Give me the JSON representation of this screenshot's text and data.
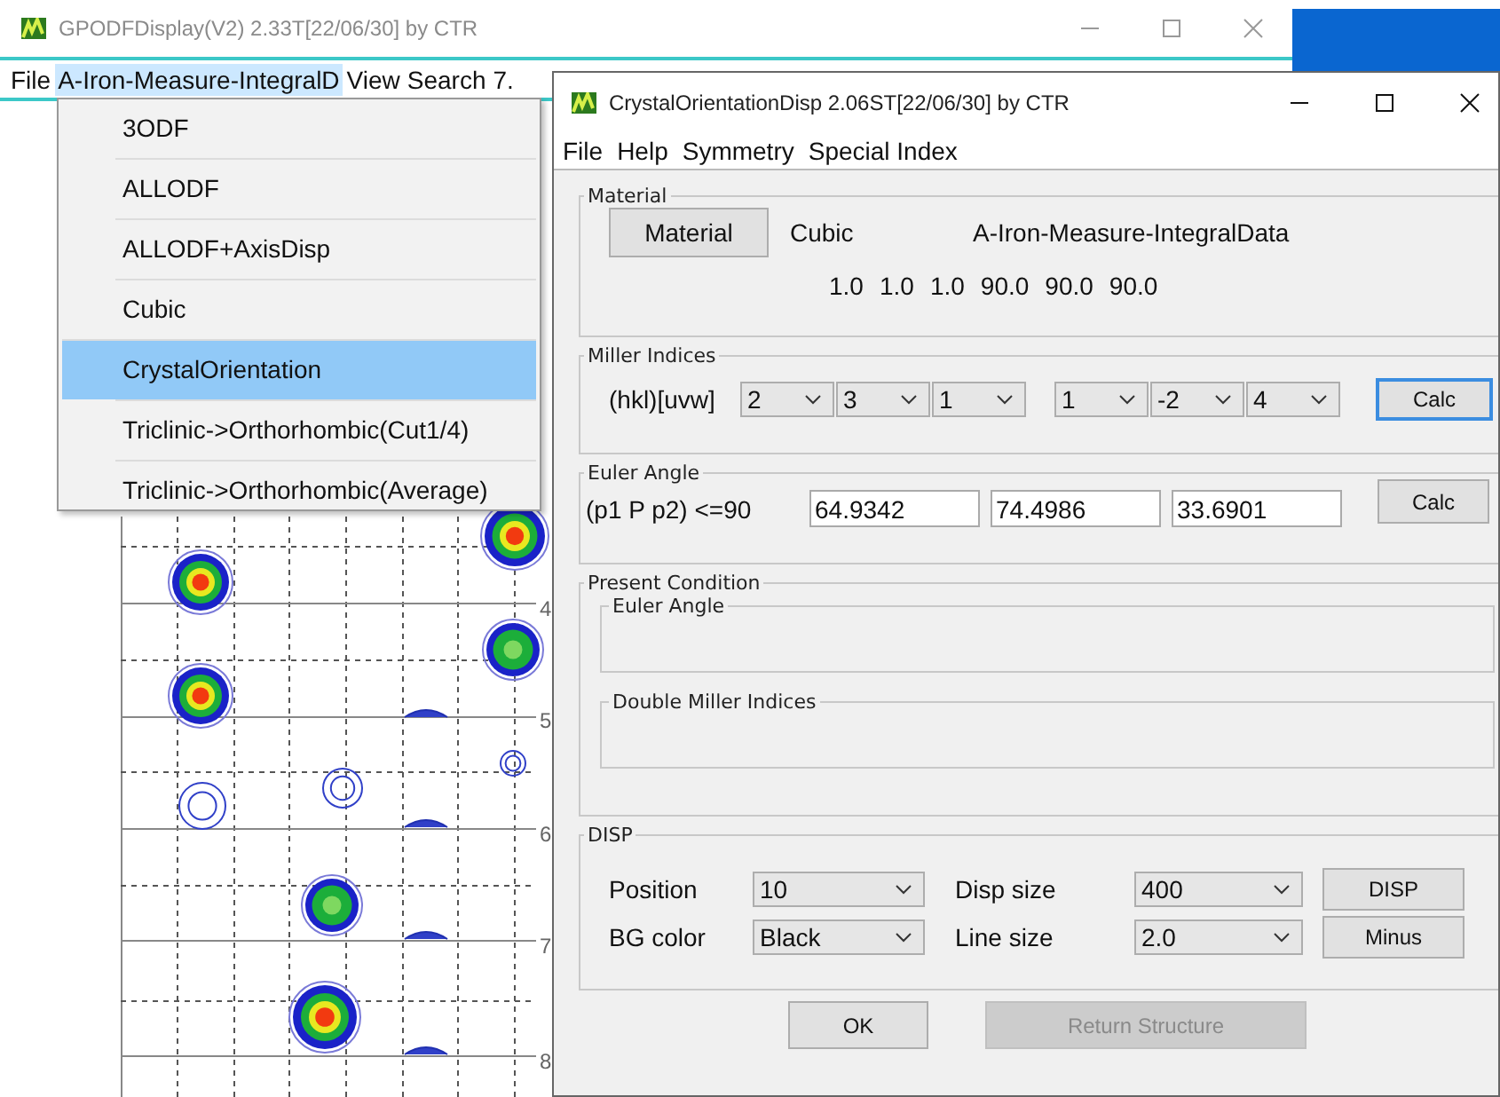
{
  "main_window": {
    "title": "GPODFDisplay(V2) 2.33T[22/06/30] by CTR",
    "menu": [
      {
        "label": "File",
        "selected": false
      },
      {
        "label": "A-Iron-Measure-IntegralD",
        "selected": true
      },
      {
        "label": "View",
        "selected": false
      },
      {
        "label": "Search",
        "selected": false
      },
      {
        "label": "7.",
        "selected": false
      }
    ],
    "dropdown": [
      {
        "label": "3ODF",
        "selected": false
      },
      {
        "label": "ALLODF",
        "selected": false
      },
      {
        "label": "ALLODF+AxisDisp",
        "selected": false
      },
      {
        "label": "Cubic",
        "selected": false
      },
      {
        "label": "CrystalOrientation",
        "selected": true
      },
      {
        "label": "Triclinic->Orthorhombic(Cut1/4)",
        "selected": false
      },
      {
        "label": "Triclinic->Orthorhombic(Average)",
        "selected": false
      }
    ],
    "plot": {
      "row_labels": [
        "4",
        "5",
        "6",
        "7",
        "8"
      ]
    }
  },
  "dialog": {
    "title": "CrystalOrientationDisp 2.06ST[22/06/30] by CTR",
    "menu": [
      "File",
      "Help",
      "Symmetry",
      "Special Index"
    ],
    "material": {
      "legend": "Material",
      "button": "Material",
      "system": "Cubic",
      "name": "A-Iron-Measure-IntegralData",
      "lattice": [
        "1.0",
        "1.0",
        "1.0",
        "90.0",
        "90.0",
        "90.0"
      ]
    },
    "miller": {
      "legend": "Miller Indices",
      "label": "(hkl)[uvw]",
      "hkl": [
        "2",
        "3",
        "1"
      ],
      "uvw": [
        "1",
        "-2",
        "4"
      ],
      "button": {
        "label": "Calc",
        "focused": true
      }
    },
    "euler": {
      "legend": "Euler Angle",
      "label": "(p1 P p2) <=90",
      "values": [
        "64.9342",
        "74.4986",
        "33.6901"
      ],
      "button": {
        "label": "Calc",
        "focused": false
      }
    },
    "present": {
      "legend": "Present Condition",
      "boxes": [
        "Euler Angle",
        "Double Miller Indices"
      ]
    },
    "disp": {
      "legend": "DISP",
      "rows": [
        {
          "label": "Position",
          "value": "10",
          "label_2": "Disp size",
          "value_2": "400",
          "button": "DISP"
        },
        {
          "label": "BG color",
          "value": "Black",
          "label_2": "Line size",
          "value_2": "2.0",
          "button": "Minus"
        }
      ]
    },
    "buttons": [
      {
        "label": "OK",
        "disabled": false
      },
      {
        "label": "Return Structure",
        "disabled": true
      }
    ]
  }
}
